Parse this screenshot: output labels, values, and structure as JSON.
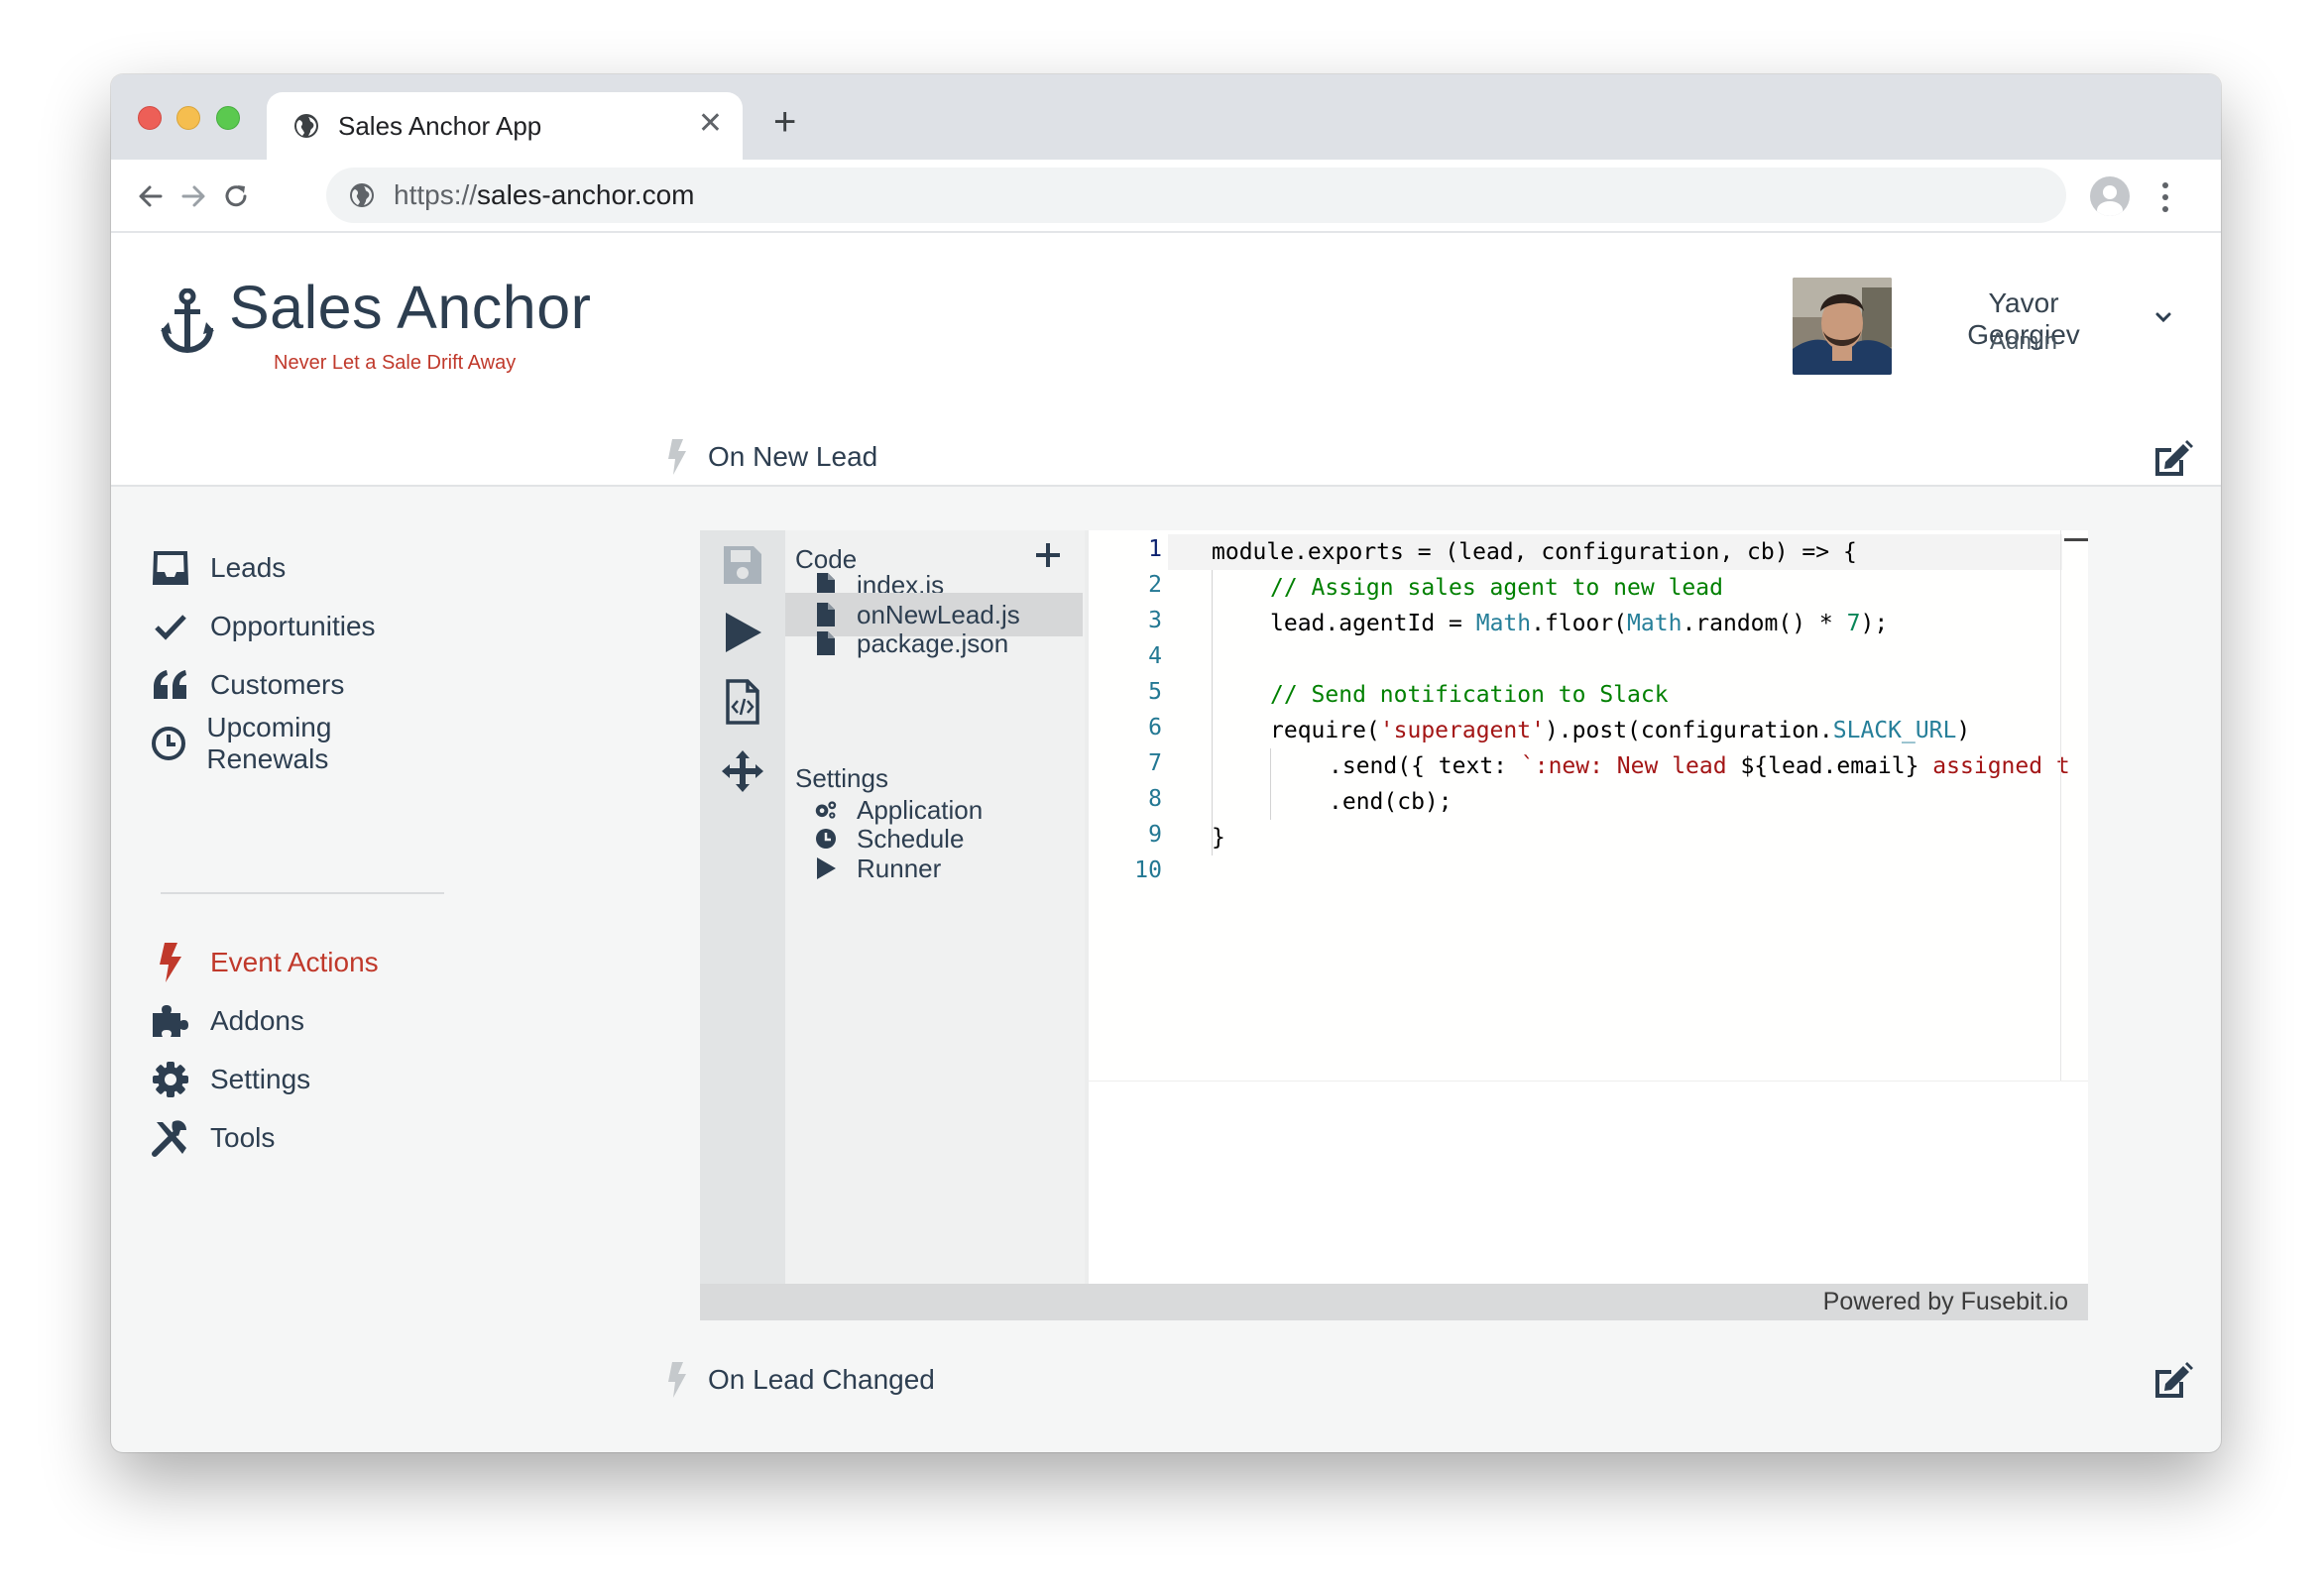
{
  "browser": {
    "tab_title": "Sales Anchor App",
    "url_scheme": "https://",
    "url_host": "sales-anchor.com"
  },
  "header": {
    "brand": "Sales Anchor",
    "tagline": "Never Let a Sale Drift Away",
    "user_name": "Yavor Georgiev",
    "user_role": "Admin"
  },
  "sidebar": {
    "items": [
      {
        "label": "Leads",
        "icon": "inbox-icon"
      },
      {
        "label": "Opportunities",
        "icon": "check-icon"
      },
      {
        "label": "Customers",
        "icon": "quote-icon"
      },
      {
        "label": "Upcoming Renewals",
        "icon": "clock-icon"
      },
      {
        "label": "Event Actions",
        "icon": "bolt-icon",
        "active": true
      },
      {
        "label": "Addons",
        "icon": "puzzle-icon"
      },
      {
        "label": "Settings",
        "icon": "gear-icon"
      },
      {
        "label": "Tools",
        "icon": "tools-icon"
      }
    ]
  },
  "events": {
    "first": "On New Lead",
    "second": "On Lead Changed"
  },
  "editor": {
    "code_heading": "Code",
    "files": [
      "index.js",
      "onNewLead.js",
      "package.json"
    ],
    "selected_file": "onNewLead.js",
    "settings_heading": "Settings",
    "settings_items": [
      "Application",
      "Schedule",
      "Runner"
    ],
    "line_numbers": [
      "1",
      "2",
      "3",
      "4",
      "5",
      "6",
      "7",
      "8",
      "9",
      "10"
    ],
    "code": {
      "l1": "module.exports = (lead, configuration, cb) => {",
      "l2_comment": "// Assign sales agent to new lead",
      "l3_a": "lead.agentId = ",
      "l3_math1": "Math",
      "l3_b": ".floor(",
      "l3_math2": "Math",
      "l3_c": ".random() * ",
      "l3_num": "7",
      "l3_d": ");",
      "l5_comment": "// Send notification to Slack",
      "l6_a": "require(",
      "l6_str": "'superagent'",
      "l6_b": ").post(configuration.",
      "l6_const": "SLACK_URL",
      "l6_c": ")",
      "l7_a": ".send({ text: ",
      "l7_str1": "`:new: New lead ",
      "l7_b": "${lead.email}",
      "l7_str2": " assigned t",
      "l8": ".end(cb);",
      "l9": "}"
    },
    "powered_by": "Powered by Fusebit.io"
  },
  "colors": {
    "accent": "#c0392b",
    "brand_text": "#2d3e50"
  }
}
